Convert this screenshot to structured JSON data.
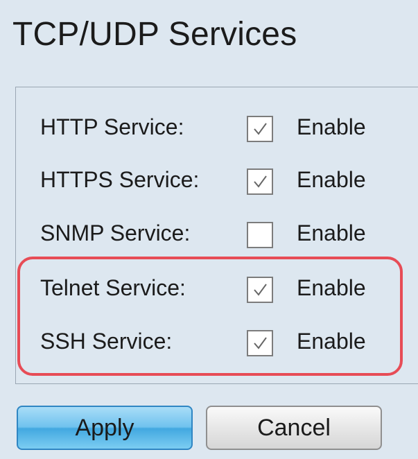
{
  "page": {
    "title": "TCP/UDP Services"
  },
  "services": [
    {
      "label": "HTTP Service:",
      "enable_label": "Enable",
      "checked": true
    },
    {
      "label": "HTTPS Service:",
      "enable_label": "Enable",
      "checked": true
    },
    {
      "label": "SNMP Service:",
      "enable_label": "Enable",
      "checked": false
    },
    {
      "label": "Telnet Service:",
      "enable_label": "Enable",
      "checked": true
    },
    {
      "label": "SSH Service:",
      "enable_label": "Enable",
      "checked": true
    }
  ],
  "buttons": {
    "apply": "Apply",
    "cancel": "Cancel"
  },
  "colors": {
    "background": "#dde7f0",
    "highlight": "#e74c56",
    "apply_button": "#42a8e0"
  }
}
